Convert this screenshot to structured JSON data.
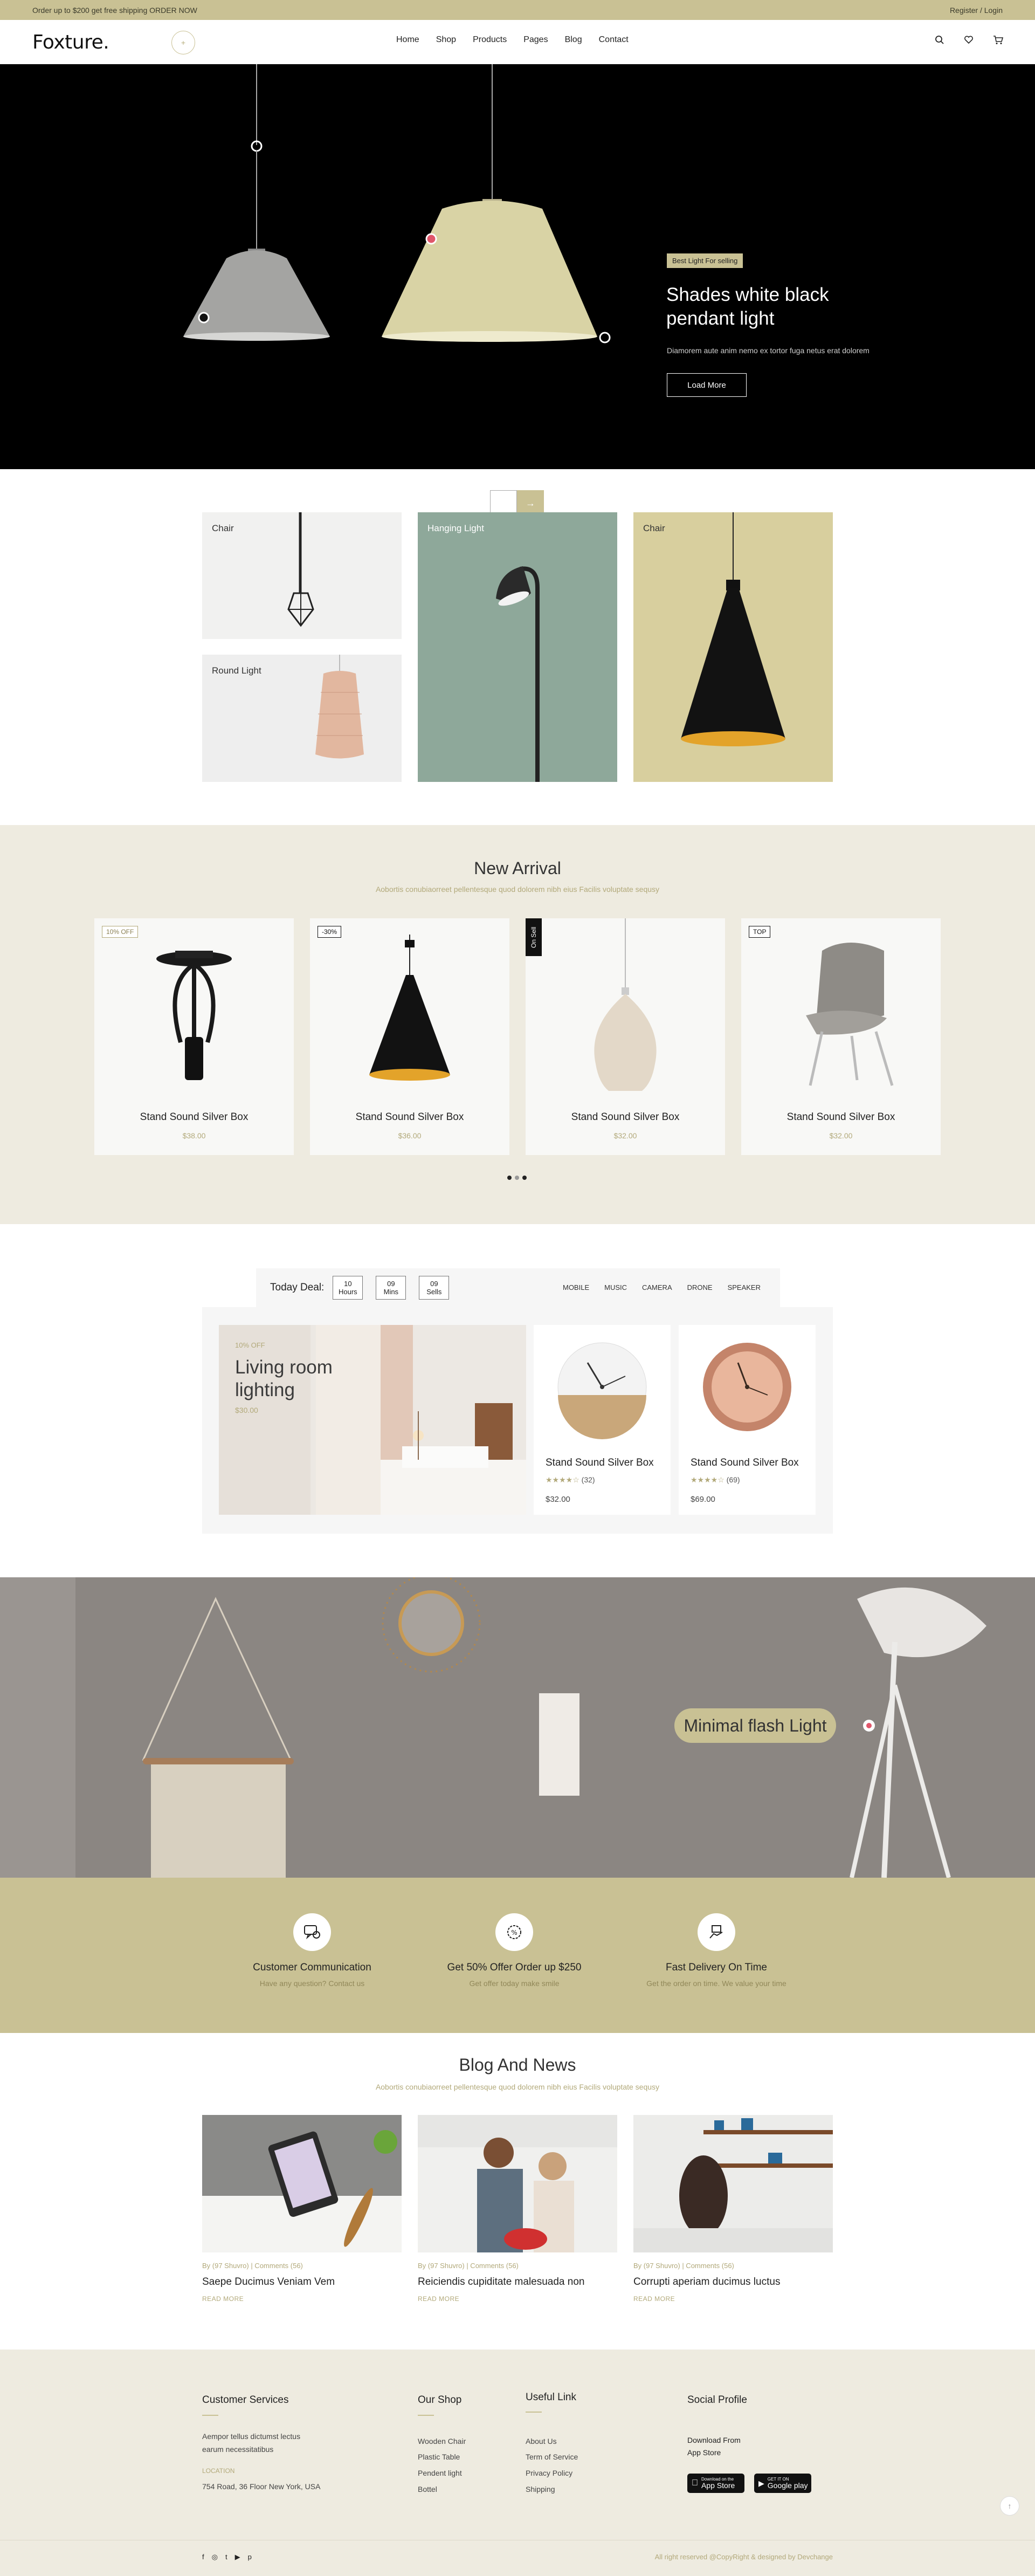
{
  "topbar": {
    "promo": "Order up to $200 get free shipping ORDER NOW",
    "account": "Register / Login"
  },
  "header": {
    "logo": "Foxture.",
    "nav": [
      "Home",
      "Shop",
      "Products",
      "Pages",
      "Blog",
      "Contact"
    ],
    "icons": [
      "search-icon",
      "heart-icon",
      "cart-icon"
    ]
  },
  "hero": {
    "badge": "Best Light For selling",
    "title": "Shades white black pendant light",
    "description": "Diamorem aute anim nemo ex tortor fuga netus erat dolorem",
    "button": "Load More"
  },
  "categories": [
    "Chair",
    "Round Light",
    "Hanging Light",
    "Chair"
  ],
  "new_arrival": {
    "title": "New Arrival",
    "subtitle": "Aobortis conubiaorreet pellentesque quod dolorem nibh eius Facilis voluptate sequsy",
    "products": [
      {
        "tag": "10% OFF",
        "name": "Stand Sound Silver Box",
        "price": "$38.00"
      },
      {
        "tag": "-30%",
        "name": "Stand Sound Silver Box",
        "price": "$36.00"
      },
      {
        "tag": "On Sell",
        "name": "Stand Sound Silver Box",
        "price": "$32.00"
      },
      {
        "tag": "TOP",
        "name": "Stand Sound Silver Box",
        "price": "$32.00"
      }
    ]
  },
  "deal": {
    "label": "Today Deal:",
    "timers": [
      {
        "value": "10",
        "unit": "Hours"
      },
      {
        "value": "09",
        "unit": "Mins"
      },
      {
        "value": "09",
        "unit": "Sells"
      }
    ],
    "tabs": [
      "MOBILE",
      "MUSIC",
      "CAMERA",
      "DRONE",
      "SPEAKER"
    ],
    "feature": {
      "off": "10% OFF",
      "title": "Living room lighting",
      "price": "$30.00"
    },
    "products": [
      {
        "name": "Stand Sound Silver Box",
        "rating": 4,
        "reviews": "(32)",
        "price": "$32.00"
      },
      {
        "name": "Stand Sound Silver Box",
        "rating": 4,
        "reviews": "(69)",
        "price": "$69.00"
      }
    ]
  },
  "banner": {
    "label": "Minimal flash Light"
  },
  "features": [
    {
      "icon": "chat-icon",
      "title": "Customer Communication",
      "subtitle": "Have any question? Contact us"
    },
    {
      "icon": "offer-icon",
      "title": "Get 50% Offer Order up $250",
      "subtitle": "Get offer today make smile"
    },
    {
      "icon": "delivery-icon",
      "title": "Fast Delivery On Time",
      "subtitle": "Get the order on time. We value your time"
    }
  ],
  "blog": {
    "title": "Blog And News",
    "subtitle": "Aobortis conubiaorreet pellentesque quod dolorem nibh eius Facilis voluptate sequsy",
    "posts": [
      {
        "meta": "By (97 Shuvro) | Comments (56)",
        "title": "Saepe Ducimus Veniam Vem",
        "more": "READ MORE"
      },
      {
        "meta": "By (97 Shuvro) | Comments (56)",
        "title": "Reiciendis cupiditate malesuada non",
        "more": "READ MORE"
      },
      {
        "meta": "By (97 Shuvro) | Comments (56)",
        "title": "Corrupti aperiam ducimus luctus",
        "more": "READ MORE"
      }
    ]
  },
  "footer": {
    "customer": {
      "title": "Customer Services",
      "text1": "Aempor tellus dictumst lectus",
      "text2": "earum necessitatibus",
      "location_label": "LOCATION",
      "address": "754 Road, 36 Floor New York, USA"
    },
    "shop": {
      "title": "Our Shop",
      "links": [
        "Wooden Chair",
        "Plastic Table",
        "Pendent light",
        "Bottel"
      ]
    },
    "useful": {
      "title": "Useful Link",
      "links": [
        "About Us",
        "Term of Service",
        "Privacy Policy",
        "Shipping"
      ]
    },
    "social": {
      "title": "Social Profile",
      "download1": "Download From",
      "download2": "App Store",
      "appstore_small": "Download on the",
      "appstore_big": "App Store",
      "gplay_small": "GET IT ON",
      "gplay_big": "Google play"
    },
    "copyright": "All right reserved @CopyRight & designed by Devchange",
    "social_icons": [
      "facebook-icon",
      "instagram-icon",
      "twitter-icon",
      "youtube-icon",
      "pinterest-icon"
    ]
  },
  "colors": {
    "accent": "#c9c194",
    "muted_text": "#b2a97a",
    "section_bg": "#eeebe0",
    "dark": "#000000"
  }
}
